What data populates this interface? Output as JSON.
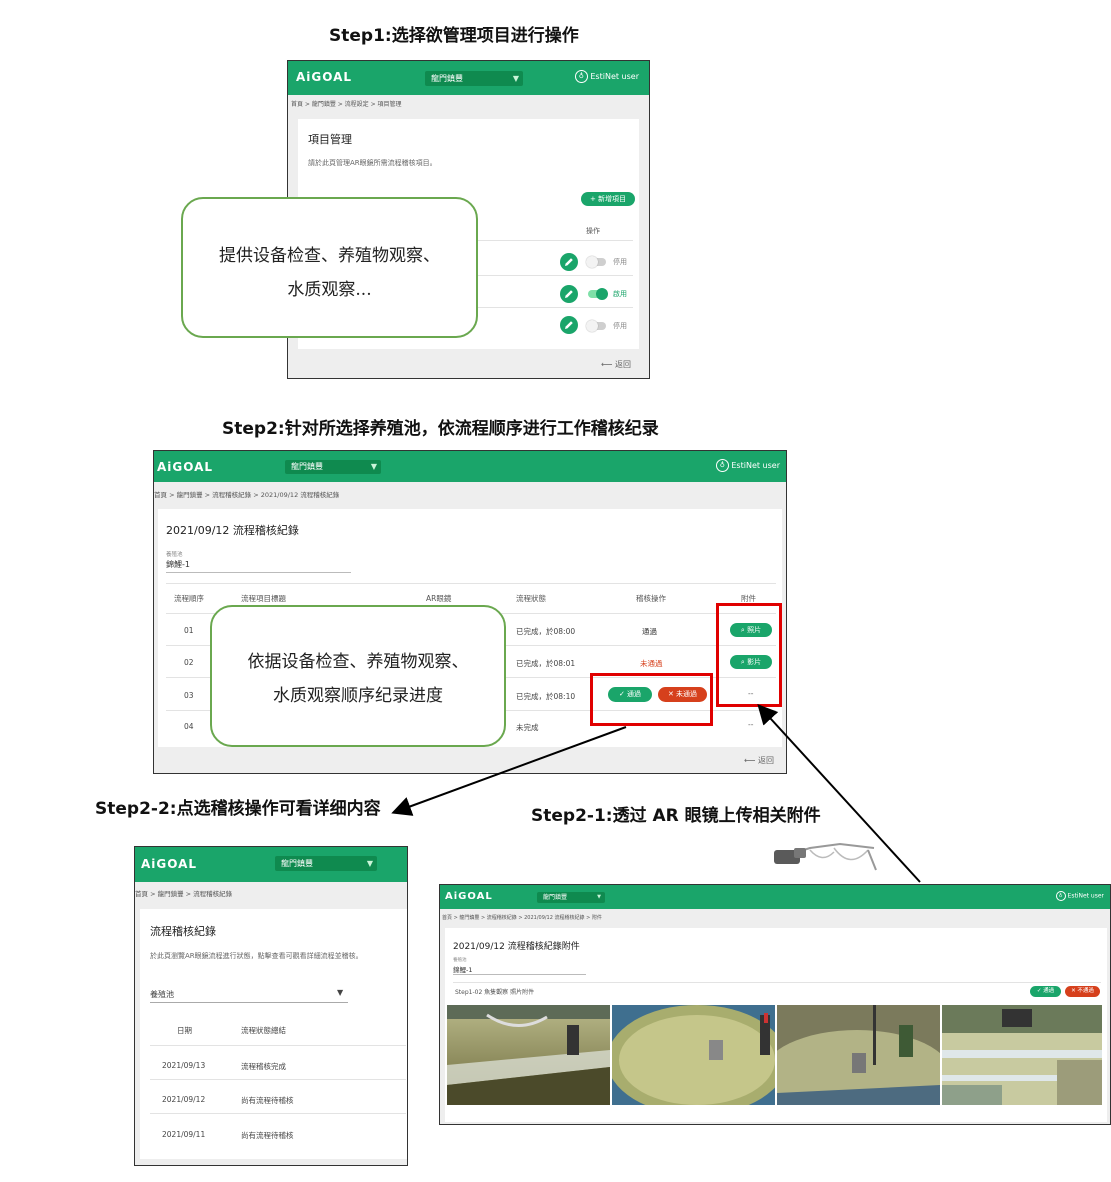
{
  "steps": {
    "step1": "Step1:选择欲管理项目进行操作",
    "step2": "Step2:针对所选择养殖池，依流程顺序进行工作稽核纪录",
    "step2_2": "Step2-2:点选稽核操作可看详细内容",
    "step2_1": "Step2-1:透过 AR 眼镜上传相关附件"
  },
  "app": {
    "logo": "AiGOAL",
    "farm_select": "龍門鎮豐",
    "user": "EstiNet user",
    "back": "返回"
  },
  "shot1": {
    "breadcrumb": "首頁 > 龍門鎮豐 > 流程設定 > 項目管理",
    "title": "項目管理",
    "desc": "請於此頁管理AR眼鏡所需流程稽核項目。",
    "add_button": "+ 新增項目",
    "col_action": "操作",
    "rows": [
      {
        "status": "停用"
      },
      {
        "status": "啟用"
      },
      {
        "status": "停用"
      }
    ],
    "callout_line1": "提供设备检查、养殖物观察、",
    "callout_line2": "水质观察..."
  },
  "shot2": {
    "breadcrumb": "首頁 > 龍門鎮豐 > 流程稽核紀錄 > 2021/09/12 流程稽核紀錄",
    "title": "2021/09/12 流程稽核紀錄",
    "pond_label": "養殖池",
    "pond_value": "錦鯉-1",
    "headers": [
      "流程順序",
      "流程項目標題",
      "AR眼鏡",
      "流程狀態",
      "稽核操作",
      "附件"
    ],
    "rows": [
      {
        "seq": "01",
        "status": "已完成，於08:00",
        "audit": "通過",
        "attach": "照片"
      },
      {
        "seq": "02",
        "status": "已完成，於08:01",
        "audit": "未通過",
        "attach": "影片"
      },
      {
        "seq": "03",
        "status": "已完成，於08:10",
        "pass_btn": "✓ 通過",
        "fail_btn": "✕ 未通過",
        "attach": "--"
      },
      {
        "seq": "04",
        "status": "未完成",
        "attach": "--"
      }
    ],
    "callout_line1": "依据设备检查、养殖物观察、",
    "callout_line2": "水质观察顺序纪录进度"
  },
  "shot3": {
    "breadcrumb": "首頁 > 龍門鎮豐 > 流程稽核紀錄",
    "title": "流程稽核紀錄",
    "desc": "於此頁瀏覽AR眼鏡流程進行狀態，點擊查看可觀看詳細流程並稽核。",
    "pond_select": "養殖池",
    "headers": [
      "日期",
      "流程狀態總結"
    ],
    "rows": [
      {
        "date": "2021/09/13",
        "summary": "流程稽核完成"
      },
      {
        "date": "2021/09/12",
        "summary": "尚有流程待稽核"
      },
      {
        "date": "2021/09/11",
        "summary": "尚有流程待稽核"
      }
    ]
  },
  "shot4": {
    "breadcrumb": "首頁 > 龍門鎮豐 > 流程稽核紀錄 > 2021/09/12 流程稽核紀錄 > 附件",
    "title": "2021/09/12 流程稽核紀錄附件",
    "pond_label": "養殖池",
    "pond_value": "錦鯉-1",
    "section": "Step1-02 魚隻觀察 照片附件",
    "pass_btn": "✓ 通過",
    "fail_btn": "✕ 不通過"
  },
  "colors": {
    "primary": "#1aa56a",
    "danger": "#d6401c",
    "highlight": "#e00000",
    "callout_border": "#6aa84f"
  }
}
